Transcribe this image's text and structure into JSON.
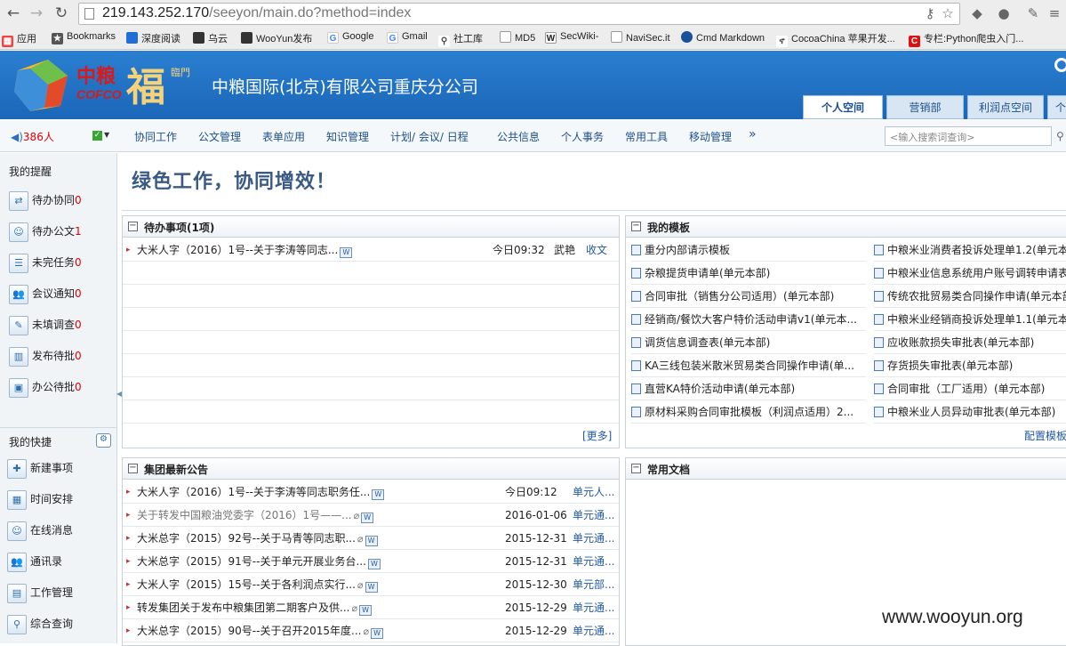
{
  "browser": {
    "url_host": "219.143.252.170",
    "url_path": "/seeyon/main.do?method=index",
    "bookmarks": [
      "应用",
      "Bookmarks",
      "深度阅读",
      "乌云",
      "WooYun发布",
      "Google",
      "Gmail",
      "社工库",
      "MD5",
      "SecWiki-",
      "NaviSec.it",
      "Cmd Markdown",
      "CocoaChina 苹果开发...",
      "专栏:Python爬虫入门..."
    ]
  },
  "header": {
    "logo_cn": "中粮",
    "logo_en": "COFCO",
    "logo_fu": "福",
    "logo_sub": "臨門",
    "company": "中粮国际(北京)有限公司重庆分公司",
    "tabs": [
      "个人空间",
      "营销部",
      "利润点空间",
      "个"
    ]
  },
  "menubar": {
    "online_count": "386人",
    "items": [
      "协同工作",
      "公文管理",
      "表单应用",
      "知识管理",
      "计划/ 会议/ 日程",
      "公共信息",
      "个人事务",
      "常用工具",
      "移动管理"
    ],
    "more": "»",
    "search_placeholder": "<输入搜索词查询>"
  },
  "sidebar": {
    "reminders_title": "我的提醒",
    "reminders": [
      {
        "label": "待办协同",
        "count": "0"
      },
      {
        "label": "待办公文",
        "count": "1"
      },
      {
        "label": "未完任务",
        "count": "0"
      },
      {
        "label": "会议通知",
        "count": "0"
      },
      {
        "label": "未填调查",
        "count": "0"
      },
      {
        "label": "发布待批",
        "count": "0"
      },
      {
        "label": "办公待批",
        "count": "0"
      }
    ],
    "shortcuts_title": "我的快捷",
    "shortcuts": [
      "新建事项",
      "时间安排",
      "在线消息",
      "通讯录",
      "工作管理",
      "综合查询"
    ]
  },
  "main": {
    "slogan": "绿色工作，协同增效！",
    "todo": {
      "title": "待办事项(1项)",
      "rows": [
        {
          "title": "大米人字（2016）1号--关于李涛等同志...",
          "time": "今日09:32",
          "person": "武艳",
          "type": "收文"
        }
      ],
      "more": "[更多]"
    },
    "templates": {
      "title": "我的模板",
      "left": [
        "重分内部请示模板",
        "杂粮提货申请单(单元本部)",
        "合同审批（销售分公司适用）(单元本部)",
        "经销商/餐饮大客户特价活动申请v1(单元本...",
        "调货信息调查表(单元本部)",
        "KA三线包装米散米贸易类合同操作申请(单...",
        "直营KA特价活动申请(单元本部)",
        "原材料采购合同审批模板（利润点适用）2..."
      ],
      "right": [
        "中粮米业消费者投诉处理单1.2(单元本",
        "中粮米业信息系统用户账号调转申请表",
        "传统农批贸易类合同操作申请(单元本部",
        "中粮米业经销商投诉处理单1.1(单元本",
        "应收账款损失审批表(单元本部)",
        "存货损失审批表(单元本部)",
        "合同审批（工厂适用）(单元本部)",
        "中粮米业人员异动审批表(单元本部)"
      ],
      "config": "配置模板"
    },
    "notices": {
      "title": "集团最新公告",
      "rows": [
        {
          "title": "大米人字（2016）1号--关于李涛等同志职务任...",
          "date": "今日09:12",
          "dept": "单元人..."
        },
        {
          "title": "关于转发中国粮油党委字（2016）1号——...",
          "date": "2016-01-06",
          "dept": "单元通..."
        },
        {
          "title": "大米总字（2015）92号--关于马青等同志职...",
          "date": "2015-12-31",
          "dept": "单元通..."
        },
        {
          "title": "大米总字（2015）91号--关于单元开展业务台...",
          "date": "2015-12-31",
          "dept": "单元通..."
        },
        {
          "title": "大米人字（2015）15号--关于各利润点实行...",
          "date": "2015-12-30",
          "dept": "单元部..."
        },
        {
          "title": "转发集团关于发布中粮集团第二期客户及供...",
          "date": "2015-12-29",
          "dept": "单元通..."
        },
        {
          "title": "大米总字（2015）90号--关于召开2015年度...",
          "date": "2015-12-29",
          "dept": "单元通..."
        }
      ]
    },
    "docs": {
      "title": "常用文档"
    }
  },
  "watermark": "www.wooyun.org"
}
